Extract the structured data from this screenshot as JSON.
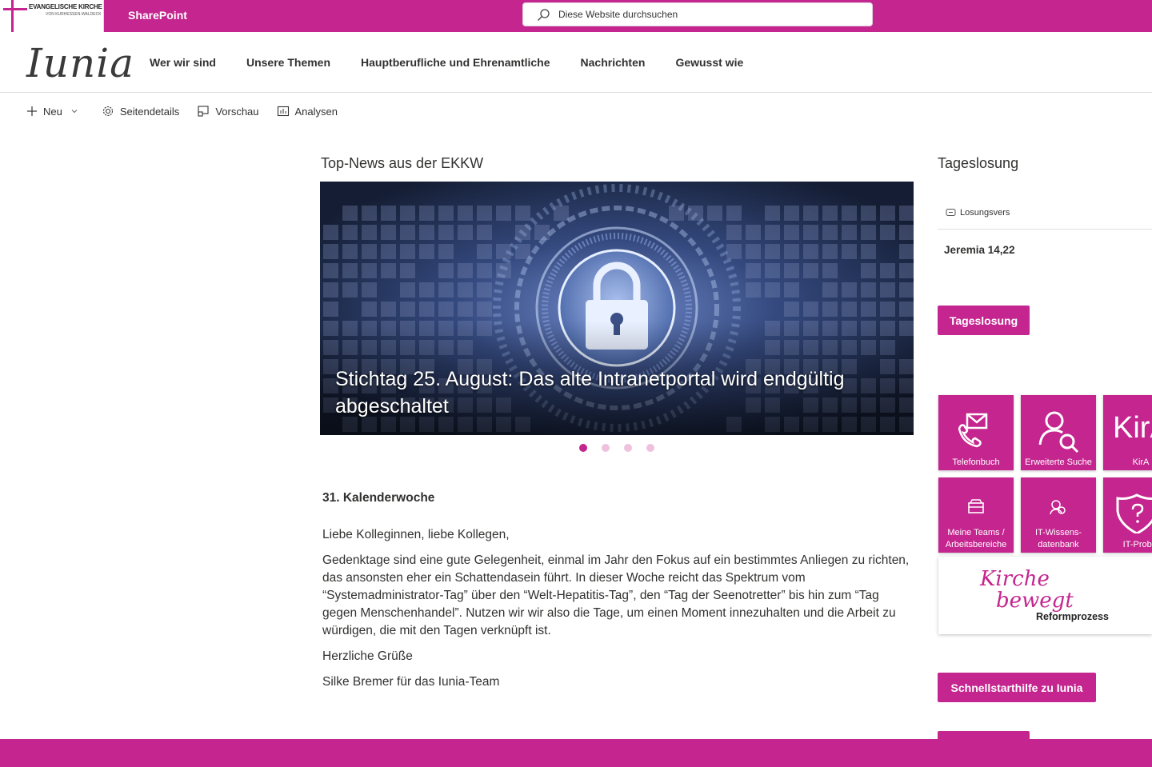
{
  "suite_bar": {
    "org_logo_line1": "EVANGELISCHE KIRCHE",
    "org_logo_line2": "VON KURHESSEN-WALDECK",
    "app_name": "SharePoint",
    "search_placeholder": "Diese Website durchsuchen"
  },
  "site": {
    "logo": "Iunia",
    "nav": [
      "Wer wir sind",
      "Unsere Themen",
      "Hauptberufliche und Ehrenamtliche",
      "Nachrichten",
      "Gewusst wie"
    ]
  },
  "command_bar": {
    "new": "Neu",
    "page_details": "Seitendetails",
    "preview": "Vorschau",
    "analytics": "Analysen"
  },
  "news": {
    "title": "Top-News aus der EKKW",
    "hero_title": "Stichtag 25. August: Das alte Intranetportal wird endgültig abgeschaltet",
    "slide_count": 4,
    "active_slide": 1
  },
  "article": {
    "week": "31. Kalenderwoche",
    "greeting": "Liebe Kolleginnen, liebe Kollegen,",
    "body": "Gedenktage sind eine gute Gelegenheit, einmal im Jahr den Fokus auf ein bestimmtes Anliegen zu richten, das ansonsten eher ein Schattendasein führt. In dieser Woche reicht das Spektrum vom “Systemadministrator-Tag” über den “Welt-Hepatitis-Tag”, den “Tag der Seenotretter” bis hin zum “Tag gegen Menschenhandel”. Nutzen wir wir also die Tage, um einen Moment innezuhalten und die Arbeit zu würdigen, die mit den Tagen verknüpft ist.",
    "closing": "Herzliche Grüße",
    "signature": "Silke Bremer für das Iunia-Team"
  },
  "sidebar": {
    "title": "Tageslosung",
    "losung_label": "Losungsvers",
    "losung_ref": "Jeremia 14,22",
    "losung_button": "Tageslosung",
    "tiles": [
      {
        "label": "Telefonbuch",
        "icon": "phone-mail-icon"
      },
      {
        "label": "Erweiterte Suche",
        "icon": "person-search-icon"
      },
      {
        "label": "KirA",
        "icon": "kira-text"
      },
      {
        "label": "Meine Teams / Arbeitsbereiche",
        "icon": "teams-icon"
      },
      {
        "label": "IT-Wissens-datenbank",
        "icon": "knowledge-icon"
      },
      {
        "label": "IT-Proble",
        "icon": "shield-question-icon"
      }
    ],
    "kira_text": "KirA",
    "banner": {
      "script_line1": "Kirche",
      "script_line2": "bewegt",
      "subtitle": "Reformprozess"
    },
    "quickstart_button": "Schnellstarthilfe zu Iunia"
  },
  "colors": {
    "brand": "#c4258e"
  }
}
